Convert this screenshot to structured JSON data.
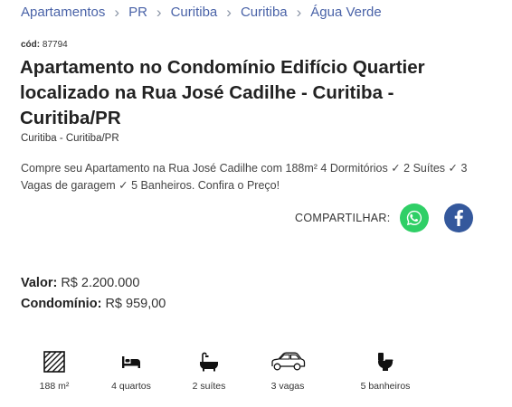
{
  "breadcrumb": [
    "Apartamentos",
    "PR",
    "Curitiba",
    "Curitiba",
    "Água Verde"
  ],
  "code": {
    "label": "cód:",
    "value": "87794"
  },
  "title": "Apartamento no Condomínio Edifício Quartier localizado na Rua José Cadilhe - Curitiba - Curitiba/PR",
  "location": "Curitiba - Curitiba/PR",
  "description": "Compre seu Apartamento na Rua José Cadilhe com 188m² 4 Dormitórios ✓ 2 Suítes ✓ 3 Vagas de garagem ✓ 5 Banheiros. Confira o Preço!",
  "share": {
    "label": "COMPARTILHAR:",
    "whatsapp_icon": "whatsapp-icon",
    "facebook_icon": "facebook-icon"
  },
  "prices": {
    "value_label": "Valor:",
    "value": "R$ 2.200.000",
    "condo_label": "Condomínio:",
    "condo": "R$ 959,00"
  },
  "features": [
    {
      "icon": "area-icon",
      "label": "188 m²"
    },
    {
      "icon": "bed-icon",
      "label": "4 quartos"
    },
    {
      "icon": "bathtub-icon",
      "label": "2 suítes"
    },
    {
      "icon": "car-icon",
      "label": "3 vagas"
    },
    {
      "icon": "toilet-icon",
      "label": "5 banheiros"
    }
  ],
  "colors": {
    "link": "#4a63a8",
    "whatsapp": "#2fcf66",
    "facebook": "#34589c"
  }
}
